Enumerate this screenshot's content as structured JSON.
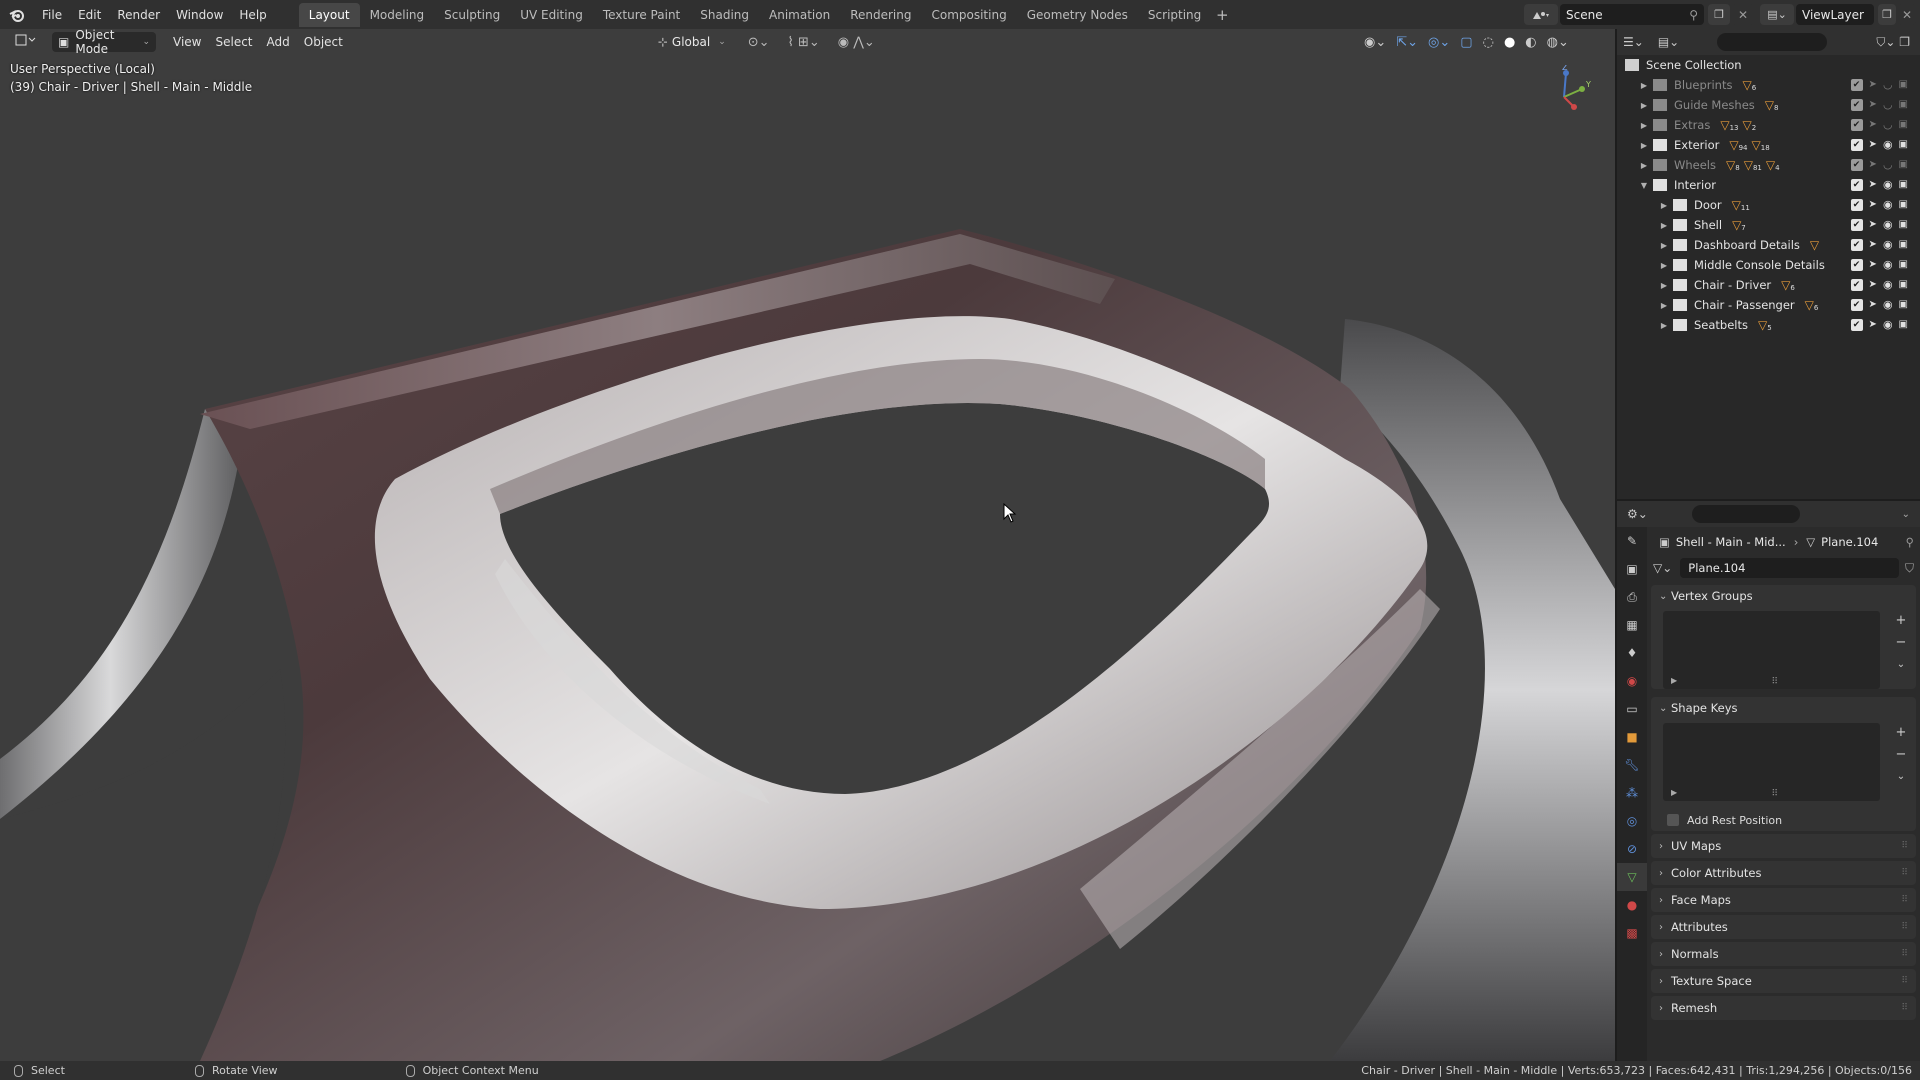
{
  "menu": [
    "File",
    "Edit",
    "Render",
    "Window",
    "Help"
  ],
  "workspaces": [
    {
      "label": "Layout",
      "active": true
    },
    {
      "label": "Modeling",
      "active": false
    },
    {
      "label": "Sculpting",
      "active": false
    },
    {
      "label": "UV Editing",
      "active": false
    },
    {
      "label": "Texture Paint",
      "active": false
    },
    {
      "label": "Shading",
      "active": false
    },
    {
      "label": "Animation",
      "active": false
    },
    {
      "label": "Rendering",
      "active": false
    },
    {
      "label": "Compositing",
      "active": false
    },
    {
      "label": "Geometry Nodes",
      "active": false
    },
    {
      "label": "Scripting",
      "active": false
    }
  ],
  "scene": {
    "name": "Scene"
  },
  "view_layer": {
    "name": "ViewLayer"
  },
  "viewport": {
    "mode": "Object Mode",
    "menus": [
      "View",
      "Select",
      "Add",
      "Object"
    ],
    "orientation": "Global",
    "perspective": "User Perspective (Local)",
    "object_info": "(39) Chair - Driver | Shell - Main - Middle",
    "gizmo_axes": {
      "z": "Z",
      "y": "Y"
    }
  },
  "outliner": {
    "root": "Scene Collection",
    "items": [
      {
        "name": "Blueprints",
        "level": 1,
        "expanded": false,
        "dim": true,
        "badges": [
          "6"
        ]
      },
      {
        "name": "Guide Meshes",
        "level": 1,
        "expanded": false,
        "dim": true,
        "badges": [
          "8"
        ]
      },
      {
        "name": "Extras",
        "level": 1,
        "expanded": false,
        "dim": true,
        "badges": [
          "13",
          "2"
        ]
      },
      {
        "name": "Exterior",
        "level": 1,
        "expanded": false,
        "dim": false,
        "badges": [
          "94",
          "18"
        ]
      },
      {
        "name": "Wheels",
        "level": 1,
        "expanded": false,
        "dim": true,
        "badges": [
          "8",
          "81",
          "4"
        ]
      },
      {
        "name": "Interior",
        "level": 1,
        "expanded": true,
        "dim": false,
        "badges": []
      },
      {
        "name": "Door",
        "level": 2,
        "expanded": false,
        "dim": false,
        "badges": [
          "11"
        ]
      },
      {
        "name": "Shell",
        "level": 2,
        "expanded": false,
        "dim": false,
        "badges": [
          "7"
        ]
      },
      {
        "name": "Dashboard Details",
        "level": 2,
        "expanded": false,
        "dim": false,
        "badges": [
          ""
        ]
      },
      {
        "name": "Middle Console Details",
        "level": 2,
        "expanded": false,
        "dim": false,
        "badges": []
      },
      {
        "name": "Chair - Driver",
        "level": 2,
        "expanded": false,
        "dim": false,
        "badges": [
          "6"
        ]
      },
      {
        "name": "Chair - Passenger",
        "level": 2,
        "expanded": false,
        "dim": false,
        "badges": [
          "6"
        ]
      },
      {
        "name": "Seatbelts",
        "level": 2,
        "expanded": false,
        "dim": false,
        "badges": [
          "5"
        ]
      }
    ]
  },
  "properties": {
    "breadcrumb_object": "Shell - Main - Mid...",
    "breadcrumb_data": "Plane.104",
    "mesh_name": "Plane.104",
    "panels": {
      "vertex_groups": "Vertex Groups",
      "shape_keys": "Shape Keys",
      "add_rest_position": "Add Rest Position"
    },
    "collapsed_panels": [
      "UV Maps",
      "Color Attributes",
      "Face Maps",
      "Attributes",
      "Normals",
      "Texture Space",
      "Remesh"
    ]
  },
  "statusbar": {
    "select": "Select",
    "rotate": "Rotate View",
    "context": "Object Context Menu",
    "stats": "Chair - Driver | Shell - Main - Middle | Verts:653,723 | Faces:642,431 | Tris:1,294,256 | Objects:0/156"
  },
  "colors": {
    "accent_blue": "#4772b3",
    "collection_icon": "#e0e0e0",
    "mesh_badge": "#e39a3a",
    "data_green": "#6bbd5b"
  }
}
